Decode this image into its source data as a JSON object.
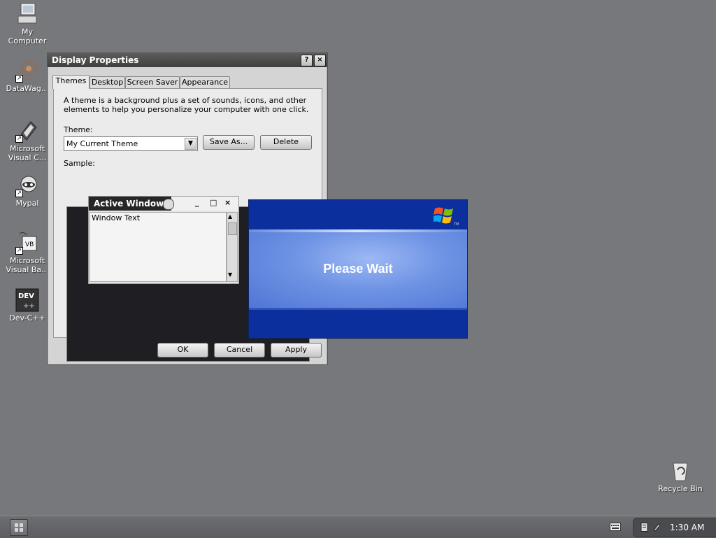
{
  "desktop": {
    "icons": [
      {
        "label": "My Computer",
        "icon": "computer-icon"
      },
      {
        "label": "DataWag...",
        "icon": "datawag-icon"
      },
      {
        "label": "Microsoft Visual C...",
        "icon": "visual-c-icon"
      },
      {
        "label": "Mypal",
        "icon": "mypal-icon"
      },
      {
        "label": "Microsoft Visual Ba...",
        "icon": "visual-basic-icon"
      },
      {
        "label": "Dev-C++",
        "icon": "dev-cpp-icon"
      },
      {
        "label": "Recycle Bin",
        "icon": "recycle-bin-icon"
      }
    ]
  },
  "window": {
    "title": "Display Properties",
    "help_button": "?",
    "close_button": "×",
    "tabs": [
      {
        "label": "Themes",
        "active": true
      },
      {
        "label": "Desktop",
        "active": false
      },
      {
        "label": "Screen Saver",
        "active": false
      },
      {
        "label": "Appearance",
        "active": false
      }
    ],
    "description": "A theme is a background plus a set of sounds, icons, and other elements to help you personalize your computer with one click.",
    "theme_label": "Theme:",
    "theme_value": "My Current Theme",
    "save_as_label": "Save As...",
    "delete_label": "Delete",
    "sample_label": "Sample:",
    "sample": {
      "active_window_title": "Active Window",
      "window_text": "Window Text",
      "minimize": "_",
      "maximize": "□",
      "close": "×"
    },
    "ok_label": "OK",
    "cancel_label": "Cancel",
    "apply_label": "Apply"
  },
  "splash": {
    "text": "Please Wait",
    "logo_tm": "TM",
    "colors": {
      "band": "#0b2f9c",
      "center": "#6e93e4"
    }
  },
  "taskbar": {
    "clock": "1:30 AM",
    "start_icon": "start-icon",
    "tray_icons": [
      "keyboard-icon",
      "tray-device-icon",
      "tray-pen-icon"
    ]
  }
}
